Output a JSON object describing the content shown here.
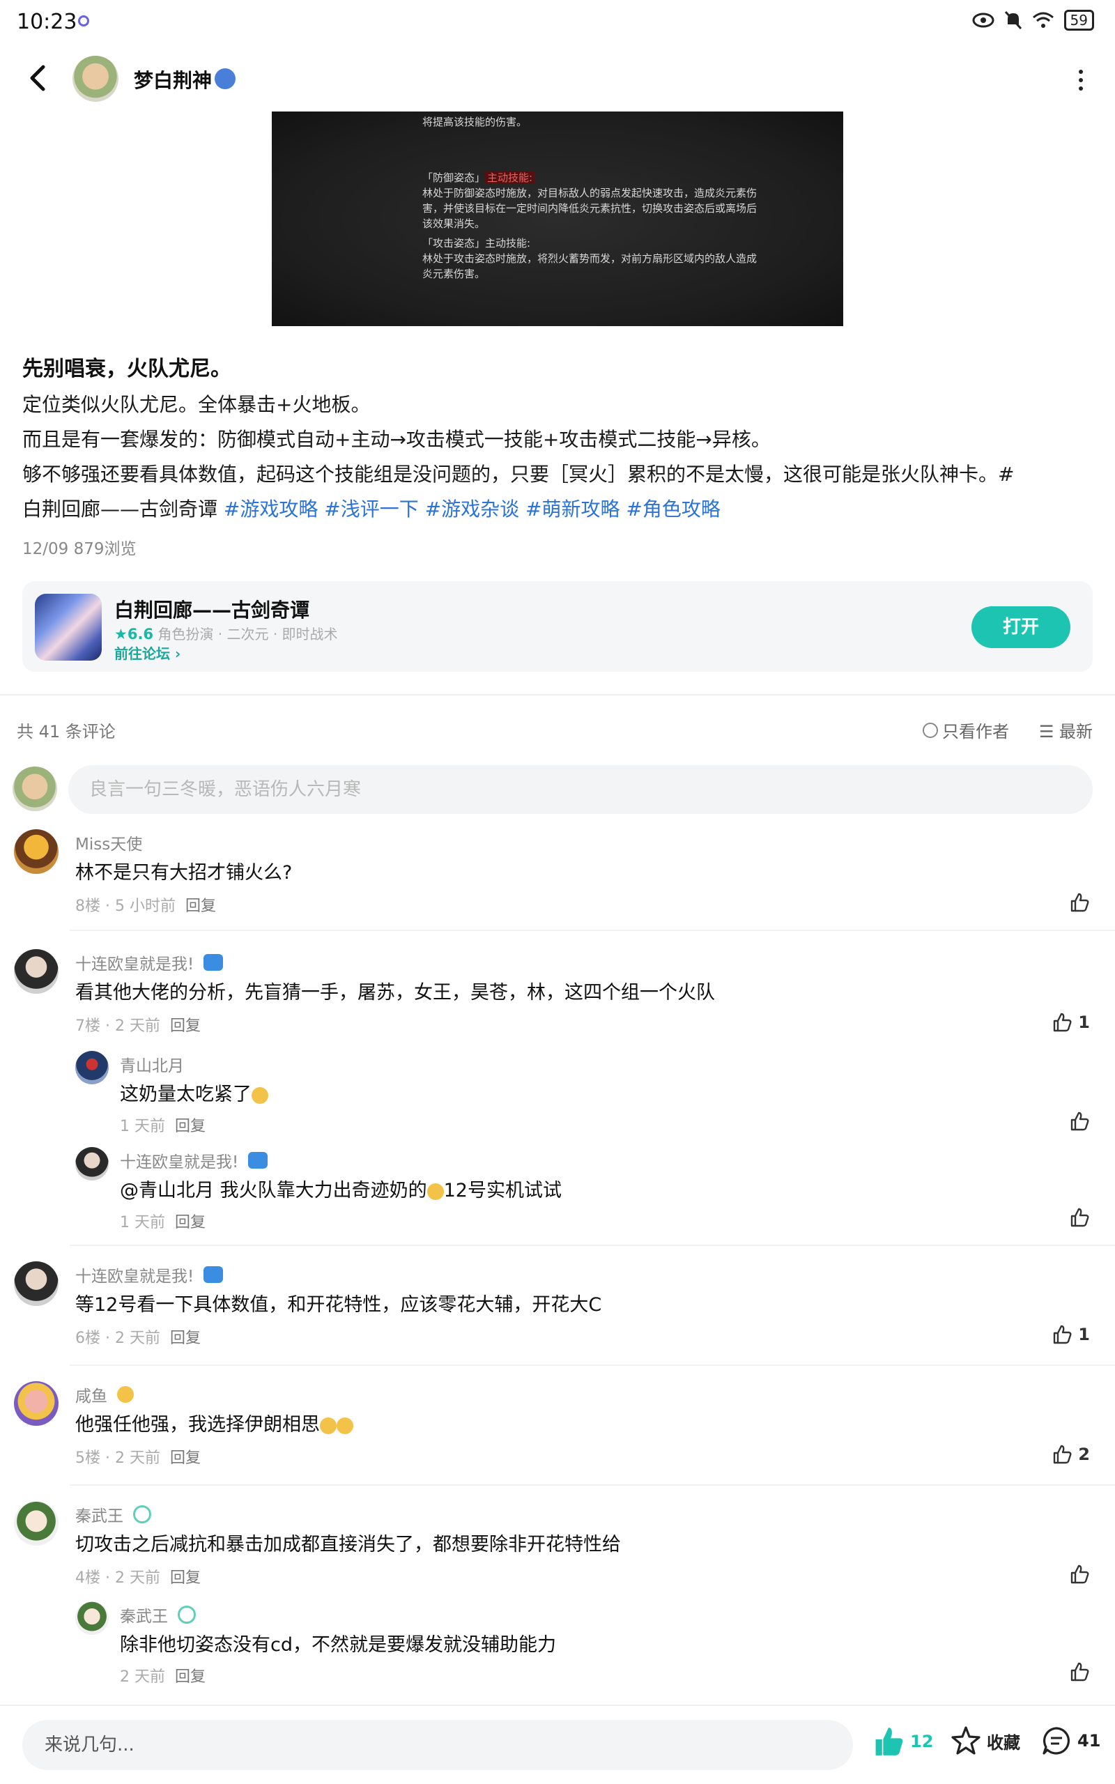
{
  "status_bar": {
    "time": "10:23",
    "battery": "59"
  },
  "header": {
    "author_name": "梦白荆神"
  },
  "post_image": {
    "lines": [
      "将提高该技能的伤害。",
      "「防御姿态」",
      "主动技能:",
      "林处于防御姿态时施放，对目标敌人的弱点发起快速攻击，造成炎元素伤",
      "害，并使该目标在一定时间内降低炎元素抗性，切换攻击姿态后或离场后",
      "该效果消失。",
      "「攻击姿态」主动技能:",
      "林处于攻击姿态时施放，将烈火蓄势而发，对前方扇形区域内的敌人造成",
      "炎元素伤害。"
    ]
  },
  "post": {
    "title": "先别唱衰，火队尤尼。",
    "body": [
      "定位类似火队尤尼。全体暴击+火地板。",
      "而且是有一套爆发的：防御模式自动+主动→攻击模式一技能+攻击模式二技能→异核。",
      "够不够强还要看具体数值，起码这个技能组是没问题的，只要［冥火］累积的不是太慢，这很可能是张火队神卡。#"
    ],
    "body_last_prefix": "白荆回廊——古剑奇谭",
    "tags": [
      "#游戏攻略",
      "#浅评一下",
      "#游戏杂谈",
      "#萌新攻略",
      "#角色攻略"
    ],
    "meta": "12/09  879浏览"
  },
  "game_card": {
    "name": "白荆回廊——古剑奇谭",
    "rating": "★6.6",
    "genres": "角色扮演 · 二次元 · 即时战术",
    "link": "前往论坛 ›",
    "open_label": "打开"
  },
  "comments_header": {
    "count": "共 41 条评论",
    "only_author": "只看作者",
    "sort": "☰ 最新"
  },
  "comment_input": {
    "placeholder": "良言一句三冬暖，恶语伤人六月寒"
  },
  "comments": [
    {
      "name": "Miss天使",
      "text": "林不是只有大招才铺火么?",
      "floor": "8楼 · 5 小时前",
      "reply": "回复",
      "likes": ""
    },
    {
      "name": "十连欧皇就是我!",
      "text": "看其他大佬的分析，先盲猜一手，屠苏，女王，昊苍，林，这四个组一个火队",
      "floor": "7楼 · 2 天前",
      "reply": "回复",
      "likes": "1",
      "replies": [
        {
          "name": "青山北月",
          "text": "这奶量太吃紧了",
          "time": "1 天前",
          "reply": "回复"
        },
        {
          "name": "十连欧皇就是我!",
          "text": "@青山北月  我火队靠大力出奇迹奶的",
          "text2": "12号实机试试",
          "time": "1 天前",
          "reply": "回复"
        }
      ]
    },
    {
      "name": "十连欧皇就是我!",
      "text": "等12号看一下具体数值，和开花特性，应该零花大辅，开花大C",
      "floor": "6楼 · 2 天前",
      "reply": "回复",
      "likes": "1"
    },
    {
      "name": "咸鱼",
      "text": "他强任他强，我选择伊朗相思",
      "floor": "5楼 · 2 天前",
      "reply": "回复",
      "likes": "2"
    },
    {
      "name": "秦武王",
      "text": "切攻击之后减抗和暴击加成都直接消失了，都想要除非开花特性给",
      "floor": "4楼 · 2 天前",
      "reply": "回复",
      "likes": "",
      "replies": [
        {
          "name": "秦武王",
          "text": "除非他切姿态没有cd，不然就是要爆发就没辅助能力",
          "time": "2 天前",
          "reply": "回复"
        }
      ]
    }
  ],
  "bottom_bar": {
    "placeholder": "来说几句...",
    "likes": "12",
    "favorite": "收藏",
    "comments": "41"
  },
  "colors": {
    "accent": "#1cc4b1",
    "tag": "#2b73d6"
  }
}
